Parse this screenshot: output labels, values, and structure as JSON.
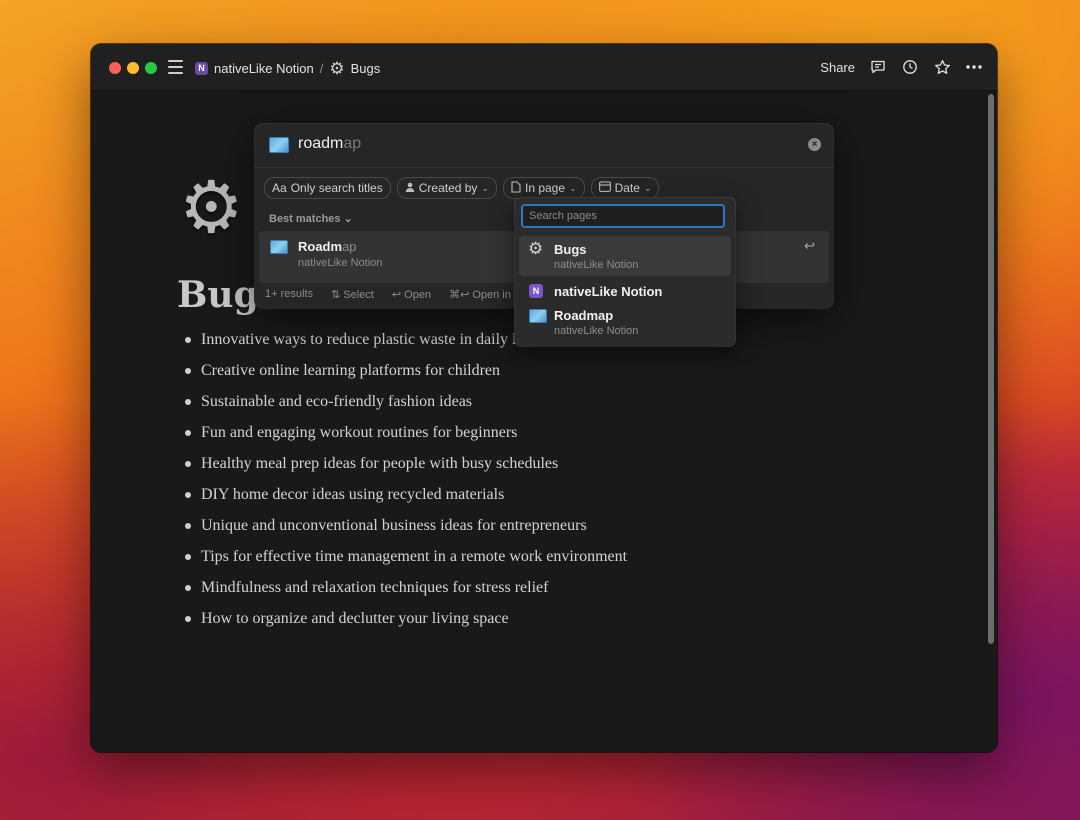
{
  "window": {
    "breadcrumb": {
      "workspace": "nativeLike Notion",
      "separator": "/",
      "page": "Bugs"
    },
    "toolbar": {
      "share_label": "Share"
    }
  },
  "page": {
    "title": "Bugs",
    "items": [
      "Innovative ways to reduce plastic waste in daily li",
      "Creative online learning platforms for children",
      "Sustainable and eco-friendly fashion ideas",
      "Fun and engaging workout routines for beginners",
      "Healthy meal prep ideas for people with busy schedules",
      "DIY home decor ideas using recycled materials",
      "Unique and unconventional business ideas for entrepreneurs",
      "Tips for effective time management in a remote work environment",
      "Mindfulness and relaxation techniques for stress relief",
      "How to organize and declutter your living space"
    ]
  },
  "search": {
    "query_typed": "roadm",
    "query_completion": "ap",
    "filters": {
      "titles": "Only search titles",
      "created_by": "Created by",
      "in_page": "In page",
      "date": "Date"
    },
    "section_label": "Best matches",
    "result": {
      "title_typed": "Roadm",
      "title_rest": "ap",
      "subtitle": "nativeLike Notion"
    },
    "footer": {
      "results": "1+ results",
      "select": "Select",
      "open": "Open",
      "open_in": "Open in a"
    }
  },
  "dropdown": {
    "search_placeholder": "Search pages",
    "items": [
      {
        "title": "Bugs",
        "subtitle": "nativeLike Notion"
      },
      {
        "title": "nativeLike Notion",
        "subtitle": ""
      },
      {
        "title": "Roadmap",
        "subtitle": "nativeLike Notion"
      }
    ]
  },
  "colors": {
    "accent_focus": "#2a77c0",
    "window_bg": "#191919"
  }
}
